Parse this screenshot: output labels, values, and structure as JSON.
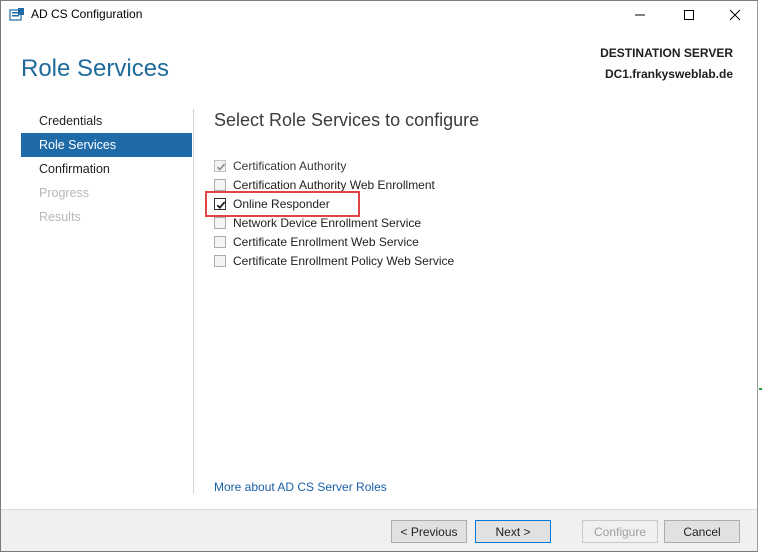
{
  "window": {
    "title": "AD CS Configuration",
    "minimize_glyph": "—",
    "close_glyph": "✕"
  },
  "header": {
    "title": "Role Services",
    "destination_label": "DESTINATION SERVER",
    "destination_server": "DC1.frankysweblab.de"
  },
  "sidebar": {
    "items": [
      {
        "label": "Credentials",
        "state": "normal"
      },
      {
        "label": "Role Services",
        "state": "active"
      },
      {
        "label": "Confirmation",
        "state": "normal"
      },
      {
        "label": "Progress",
        "state": "disabled"
      },
      {
        "label": "Results",
        "state": "disabled"
      }
    ]
  },
  "content": {
    "title": "Select Role Services to configure",
    "roles": [
      {
        "label": "Certification Authority",
        "checked": true,
        "enabled": false
      },
      {
        "label": "Certification Authority Web Enrollment",
        "checked": false,
        "enabled": true
      },
      {
        "label": "Online Responder",
        "checked": true,
        "enabled": true
      },
      {
        "label": "Network Device Enrollment Service",
        "checked": false,
        "enabled": true
      },
      {
        "label": "Certificate Enrollment Web Service",
        "checked": false,
        "enabled": true
      },
      {
        "label": "Certificate Enrollment Policy Web Service",
        "checked": false,
        "enabled": true
      }
    ],
    "more_link": "More about AD CS Server Roles"
  },
  "footer": {
    "previous_label": "< Previous",
    "next_label": "Next >",
    "configure_label": "Configure",
    "cancel_label": "Cancel"
  },
  "colors": {
    "accent": "#1f6ba8",
    "title_blue": "#1e6b9c",
    "link": "#1a5fa8",
    "highlight": "#e04444"
  }
}
